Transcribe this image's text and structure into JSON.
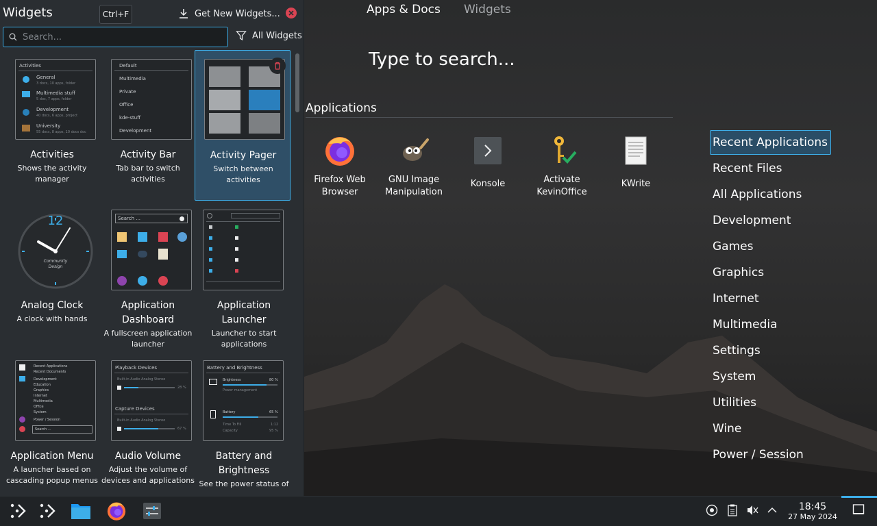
{
  "widgets_panel": {
    "title": "Widgets",
    "shortcut": "Ctrl+F",
    "get_new_label": "Get New Widgets...",
    "search_placeholder": "Search...",
    "filter_label": "All Widgets",
    "cards": [
      {
        "name": "Activities",
        "desc": "Shows the activity manager"
      },
      {
        "name": "Activity Bar",
        "desc": "Tab bar to switch activities"
      },
      {
        "name": "Activity Pager",
        "desc": "Switch between activities"
      },
      {
        "name": "Analog Clock",
        "desc": "A clock with hands"
      },
      {
        "name": "Application Dashboard",
        "desc": "A fullscreen application launcher"
      },
      {
        "name": "Application Launcher",
        "desc": "Launcher to start applications"
      },
      {
        "name": "Application Menu",
        "desc": "A launcher based on cascading popup menus"
      },
      {
        "name": "Audio Volume",
        "desc": "Adjust the volume of devices and applications"
      },
      {
        "name": "Battery and Brightness",
        "desc": "See the power status of"
      }
    ],
    "previews": {
      "activities": {
        "header": "Activities",
        "items": [
          {
            "name": "General",
            "sub": "3 docs, 10 apps, folder"
          },
          {
            "name": "Multimedia stuff",
            "sub": "5 doc, 7 apps, folder"
          },
          {
            "name": "Development",
            "sub": "40 docs, 6 apps, project"
          },
          {
            "name": "University",
            "sub": "55 docs, 8 apps, 10 docs doc"
          }
        ]
      },
      "activity_bar": {
        "items": [
          "Default",
          "Multimedia",
          "Private",
          "Office",
          "kde-stuff",
          "Development"
        ]
      },
      "analog_clock": {
        "number": "12",
        "caption_1": "Community",
        "caption_2": "Design"
      },
      "dashboard": {
        "search": "Search ..."
      },
      "app_menu": {
        "items": [
          "Recent Applications",
          "Recent Documents",
          "Development",
          "Education",
          "Graphics",
          "Internet",
          "Multimedia",
          "Office",
          "System",
          "Power / Session"
        ],
        "search": "Search ..."
      },
      "audio_volume": {
        "playback_header": "Playback Devices",
        "playback_device": "Built-in Audio Analog Stereo",
        "playback_pct": "28 %",
        "capture_header": "Capture Devices",
        "capture_device": "Built-in Audio Analog Stereo",
        "capture_pct": "67 %",
        "playback_level": 0.28,
        "capture_level": 0.67
      },
      "battery": {
        "header": "Battery and Brightness",
        "brightness_label": "Brightness",
        "brightness_pct": "80 %",
        "brightness_level": 0.8,
        "power_mgmt": "Power management",
        "battery_label": "Battery",
        "battery_pct": "65 %",
        "battery_level": 0.65,
        "time_label": "Time To Fill",
        "time_value": "1:12",
        "capacity_label": "Capacity",
        "capacity_value": "95 %"
      }
    }
  },
  "launcher": {
    "tabs": [
      "Apps & Docs",
      "Widgets"
    ],
    "search_prompt": "Type to search...",
    "section": "Applications",
    "apps": [
      "Firefox Web Browser",
      "GNU Image Manipulation",
      "Konsole",
      "Activate KevinOffice",
      "KWrite"
    ],
    "categories": [
      "Recent Applications",
      "Recent Files",
      "All Applications",
      "Development",
      "Games",
      "Graphics",
      "Internet",
      "Multimedia",
      "Settings",
      "System",
      "Utilities",
      "Wine",
      "Power / Session"
    ]
  },
  "taskbar": {
    "time": "18:45",
    "date": "27 May 2024"
  },
  "colors": {
    "accent": "#3daee9",
    "close": "#da4453",
    "panel_bg": "#2a2e32",
    "selected_bg": "#2f4f67"
  }
}
